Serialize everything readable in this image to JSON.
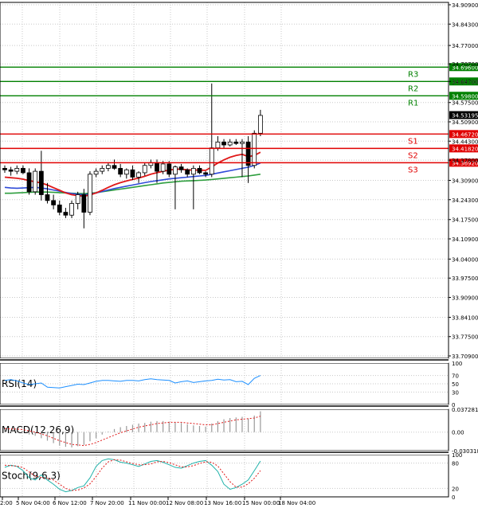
{
  "chart_data": {
    "type": "candlestick",
    "price_ticks": [
      "34.90900",
      "34.84300",
      "34.77000",
      "34.70700",
      "34.64700",
      "34.57500",
      "34.50900",
      "34.44300",
      "34.37800",
      "34.30900",
      "34.24300",
      "34.17500",
      "34.10900",
      "34.04000",
      "33.97500",
      "33.90900",
      "33.84100",
      "33.77500",
      "33.70900"
    ],
    "time_labels": [
      "2:00",
      "5 Nov 04:00",
      "6 Nov 12:00",
      "7 Nov 20:00",
      "11 Nov 00:00",
      "12 Nov 08:00",
      "13 Nov 16:00",
      "15 Nov 00:00",
      "18 Nov 04:00"
    ],
    "levels": [
      {
        "name": "R3",
        "value": 34.696,
        "label": "34.69600",
        "color": "#008000"
      },
      {
        "name": "R2",
        "value": 34.647,
        "label": "34.64700",
        "color": "#008000"
      },
      {
        "name": "R1",
        "value": 34.598,
        "label": "34.59800",
        "color": "#008000"
      },
      {
        "name": "S1",
        "value": 34.4672,
        "label": "34.46720",
        "color": "#e00000"
      },
      {
        "name": "S2",
        "value": 34.4182,
        "label": "34.41820",
        "color": "#e00000"
      },
      {
        "name": "S3",
        "value": 34.3692,
        "label": "34.36920",
        "color": "#e00000"
      }
    ],
    "current_price": "34.53195",
    "candles": [
      {
        "o": 34.35,
        "h": 34.36,
        "l": 34.335,
        "c": 34.345
      },
      {
        "o": 34.345,
        "h": 34.355,
        "l": 34.325,
        "c": 34.34
      },
      {
        "o": 34.34,
        "h": 34.36,
        "l": 34.33,
        "c": 34.35
      },
      {
        "o": 34.35,
        "h": 34.36,
        "l": 34.33,
        "c": 34.335
      },
      {
        "o": 34.335,
        "h": 34.35,
        "l": 34.26,
        "c": 34.27
      },
      {
        "o": 34.27,
        "h": 34.35,
        "l": 34.26,
        "c": 34.34
      },
      {
        "o": 34.34,
        "h": 34.41,
        "l": 34.24,
        "c": 34.26
      },
      {
        "o": 34.26,
        "h": 34.3,
        "l": 34.23,
        "c": 34.24
      },
      {
        "o": 34.24,
        "h": 34.26,
        "l": 34.21,
        "c": 34.225
      },
      {
        "o": 34.225,
        "h": 34.24,
        "l": 34.19,
        "c": 34.2
      },
      {
        "o": 34.2,
        "h": 34.215,
        "l": 34.18,
        "c": 34.19
      },
      {
        "o": 34.19,
        "h": 34.24,
        "l": 34.18,
        "c": 34.23
      },
      {
        "o": 34.23,
        "h": 34.27,
        "l": 34.21,
        "c": 34.26
      },
      {
        "o": 34.26,
        "h": 34.28,
        "l": 34.145,
        "c": 34.2
      },
      {
        "o": 34.2,
        "h": 34.34,
        "l": 34.19,
        "c": 34.33
      },
      {
        "o": 34.33,
        "h": 34.35,
        "l": 34.32,
        "c": 34.34
      },
      {
        "o": 34.34,
        "h": 34.36,
        "l": 34.33,
        "c": 34.35
      },
      {
        "o": 34.35,
        "h": 34.37,
        "l": 34.34,
        "c": 34.36
      },
      {
        "o": 34.36,
        "h": 34.38,
        "l": 34.345,
        "c": 34.35
      },
      {
        "o": 34.35,
        "h": 34.365,
        "l": 34.32,
        "c": 34.33
      },
      {
        "o": 34.33,
        "h": 34.35,
        "l": 34.315,
        "c": 34.345
      },
      {
        "o": 34.345,
        "h": 34.36,
        "l": 34.31,
        "c": 34.32
      },
      {
        "o": 34.32,
        "h": 34.34,
        "l": 34.3,
        "c": 34.335
      },
      {
        "o": 34.335,
        "h": 34.37,
        "l": 34.325,
        "c": 34.36
      },
      {
        "o": 34.36,
        "h": 34.38,
        "l": 34.35,
        "c": 34.37
      },
      {
        "o": 34.37,
        "h": 34.38,
        "l": 34.3,
        "c": 34.34
      },
      {
        "o": 34.34,
        "h": 34.375,
        "l": 34.33,
        "c": 34.365
      },
      {
        "o": 34.365,
        "h": 34.375,
        "l": 34.32,
        "c": 34.33
      },
      {
        "o": 34.33,
        "h": 34.36,
        "l": 34.21,
        "c": 34.355
      },
      {
        "o": 34.355,
        "h": 34.365,
        "l": 34.335,
        "c": 34.345
      },
      {
        "o": 34.345,
        "h": 34.35,
        "l": 34.32,
        "c": 34.33
      },
      {
        "o": 34.33,
        "h": 34.36,
        "l": 34.21,
        "c": 34.35
      },
      {
        "o": 34.35,
        "h": 34.36,
        "l": 34.33,
        "c": 34.335
      },
      {
        "o": 34.335,
        "h": 34.34,
        "l": 34.32,
        "c": 34.33
      },
      {
        "o": 34.33,
        "h": 34.64,
        "l": 34.32,
        "c": 34.42
      },
      {
        "o": 34.42,
        "h": 34.46,
        "l": 34.41,
        "c": 34.44
      },
      {
        "o": 34.44,
        "h": 34.45,
        "l": 34.42,
        "c": 34.43
      },
      {
        "o": 34.43,
        "h": 34.45,
        "l": 34.425,
        "c": 34.44
      },
      {
        "o": 34.44,
        "h": 34.45,
        "l": 34.43,
        "c": 34.435
      },
      {
        "o": 34.435,
        "h": 34.45,
        "l": 34.32,
        "c": 34.44
      },
      {
        "o": 34.44,
        "h": 34.46,
        "l": 34.3,
        "c": 34.36
      },
      {
        "o": 34.36,
        "h": 34.48,
        "l": 34.35,
        "c": 34.47
      },
      {
        "o": 34.47,
        "h": 34.55,
        "l": 34.46,
        "c": 34.531
      }
    ],
    "ma_blue": [
      34.285,
      34.283,
      34.282,
      34.283,
      34.284,
      34.285,
      34.283,
      34.28,
      34.276,
      34.272,
      34.268,
      34.264,
      34.262,
      34.26,
      34.262,
      34.266,
      34.271,
      34.276,
      34.281,
      34.285,
      34.289,
      34.293,
      34.297,
      34.301,
      34.305,
      34.308,
      34.311,
      34.314,
      34.316,
      34.318,
      34.32,
      34.322,
      34.324,
      34.326,
      34.33,
      34.334,
      34.338,
      34.342,
      34.346,
      34.35,
      34.354,
      34.36,
      34.368
    ],
    "ma_green": [
      34.265,
      34.265,
      34.266,
      34.267,
      34.268,
      34.269,
      34.269,
      34.269,
      34.268,
      34.267,
      34.266,
      34.265,
      34.264,
      34.264,
      34.265,
      34.267,
      34.27,
      34.273,
      34.276,
      34.279,
      34.282,
      34.285,
      34.288,
      34.291,
      34.294,
      34.297,
      34.3,
      34.302,
      34.304,
      34.306,
      34.307,
      34.308,
      34.309,
      34.31,
      34.312,
      34.314,
      34.316,
      34.318,
      34.32,
      34.322,
      34.324,
      34.327,
      34.33
    ],
    "ma_red": [
      34.32,
      34.318,
      34.316,
      34.313,
      34.308,
      34.304,
      34.3,
      34.293,
      34.284,
      34.275,
      34.266,
      34.26,
      34.257,
      34.255,
      34.259,
      34.266,
      34.275,
      34.285,
      34.294,
      34.301,
      34.307,
      34.312,
      34.317,
      34.323,
      34.33,
      34.335,
      34.34,
      34.344,
      34.347,
      34.347,
      34.345,
      34.344,
      34.344,
      34.343,
      34.355,
      34.368,
      34.379,
      34.388,
      34.394,
      34.398,
      34.39,
      34.394,
      34.405
    ],
    "indicators": {
      "rsi": {
        "label": "RSI(14)",
        "ticks": [
          "100",
          "70",
          "50",
          "30",
          "0"
        ],
        "values": [
          58,
          60,
          57,
          52,
          48,
          50,
          52,
          42,
          41,
          40,
          43,
          46,
          49,
          48,
          52,
          56,
          58,
          58,
          57,
          56,
          58,
          58,
          57,
          60,
          62,
          60,
          59,
          58,
          52,
          55,
          57,
          53,
          55,
          57,
          58,
          61,
          59,
          60,
          55,
          56,
          48,
          63,
          70
        ]
      },
      "macd": {
        "label": "MACD(12,26,9)",
        "ticks": [
          "0.037281",
          "0.00",
          "-0.030318"
        ],
        "hist": [
          0.004,
          0.003,
          0.002,
          0.001,
          -0.004,
          -0.006,
          -0.01,
          -0.014,
          -0.018,
          -0.022,
          -0.024,
          -0.025,
          -0.023,
          -0.021,
          -0.015,
          -0.01,
          -0.004,
          0.001,
          0.005,
          0.008,
          0.01,
          0.012,
          0.014,
          0.015,
          0.017,
          0.018,
          0.018,
          0.017,
          0.016,
          0.015,
          0.013,
          0.011,
          0.01,
          0.009,
          0.014,
          0.018,
          0.021,
          0.023,
          0.024,
          0.025,
          0.022,
          0.027,
          0.034
        ],
        "signal": [
          0.006,
          0.005,
          0.005,
          0.004,
          0.002,
          0.0,
          -0.003,
          -0.006,
          -0.01,
          -0.014,
          -0.017,
          -0.02,
          -0.021,
          -0.022,
          -0.02,
          -0.017,
          -0.013,
          -0.009,
          -0.005,
          -0.001,
          0.002,
          0.005,
          0.008,
          0.01,
          0.012,
          0.014,
          0.015,
          0.016,
          0.016,
          0.016,
          0.015,
          0.014,
          0.013,
          0.012,
          0.012,
          0.014,
          0.016,
          0.018,
          0.02,
          0.021,
          0.022,
          0.023,
          0.026
        ]
      },
      "stoch": {
        "label": "Stoch(9,6,3)",
        "ticks": [
          "100",
          "80",
          "20",
          "0"
        ],
        "k": [
          70,
          75,
          72,
          62,
          45,
          40,
          52,
          40,
          30,
          18,
          12,
          15,
          22,
          26,
          45,
          72,
          86,
          90,
          88,
          82,
          80,
          76,
          72,
          78,
          84,
          86,
          82,
          76,
          70,
          68,
          74,
          80,
          84,
          86,
          75,
          60,
          30,
          18,
          22,
          30,
          40,
          62,
          85
        ],
        "d": [
          75,
          74,
          73,
          69,
          59,
          49,
          46,
          44,
          40,
          30,
          20,
          15,
          16,
          21,
          31,
          48,
          68,
          83,
          88,
          87,
          83,
          79,
          76,
          76,
          78,
          83,
          84,
          81,
          76,
          71,
          71,
          74,
          79,
          83,
          82,
          73,
          55,
          36,
          23,
          23,
          31,
          44,
          62
        ]
      }
    }
  }
}
